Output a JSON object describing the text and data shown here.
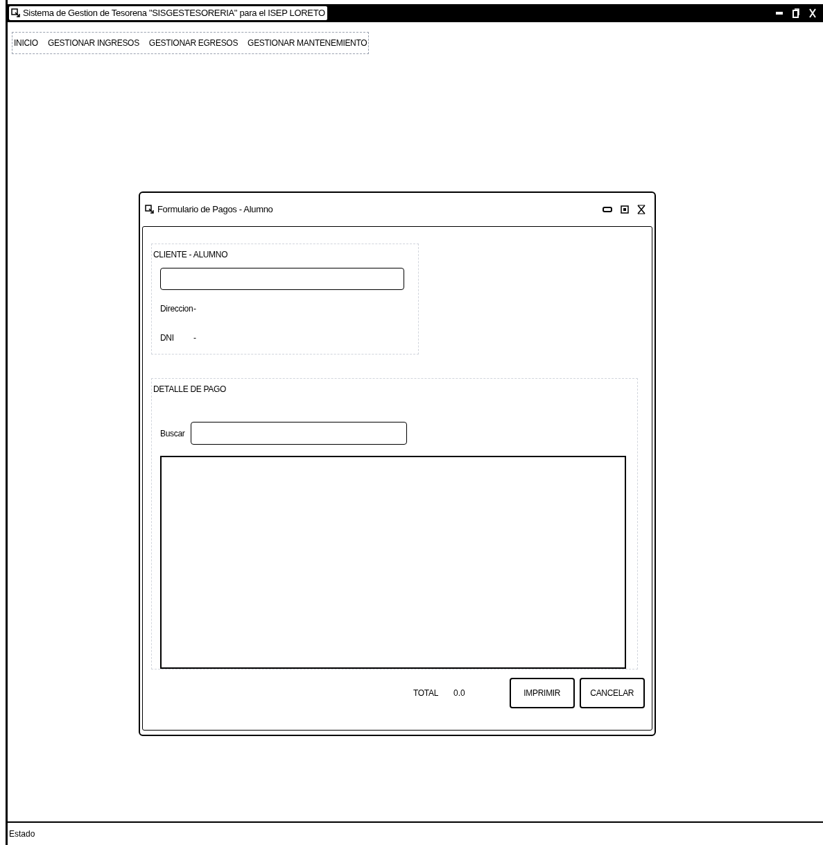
{
  "window": {
    "title": "Sistema de Gestion de Tesorena \"SISGESTESORERIA\" para el ISEP LORETO"
  },
  "menu": [
    "INICIO",
    "GESTIONAR INGRESOS",
    "GESTIONAR EGRESOS",
    "GESTIONAR MANTENEMIENTO"
  ],
  "dialog": {
    "title": "Formulario de Pagos - Alumno",
    "cliente": {
      "legend": "CLIENTE - ALUMNO",
      "labels": [
        "Direccion",
        "DNI"
      ],
      "values": [
        "-",
        "-"
      ]
    },
    "detalle": {
      "legend": "DETALLE DE PAGO",
      "search_label": "Buscar"
    },
    "total_label": "TOTAL",
    "total_value": "0.0",
    "buttons": [
      "IMPRIMIR",
      "CANCELAR"
    ]
  },
  "status_bar": "Estado"
}
